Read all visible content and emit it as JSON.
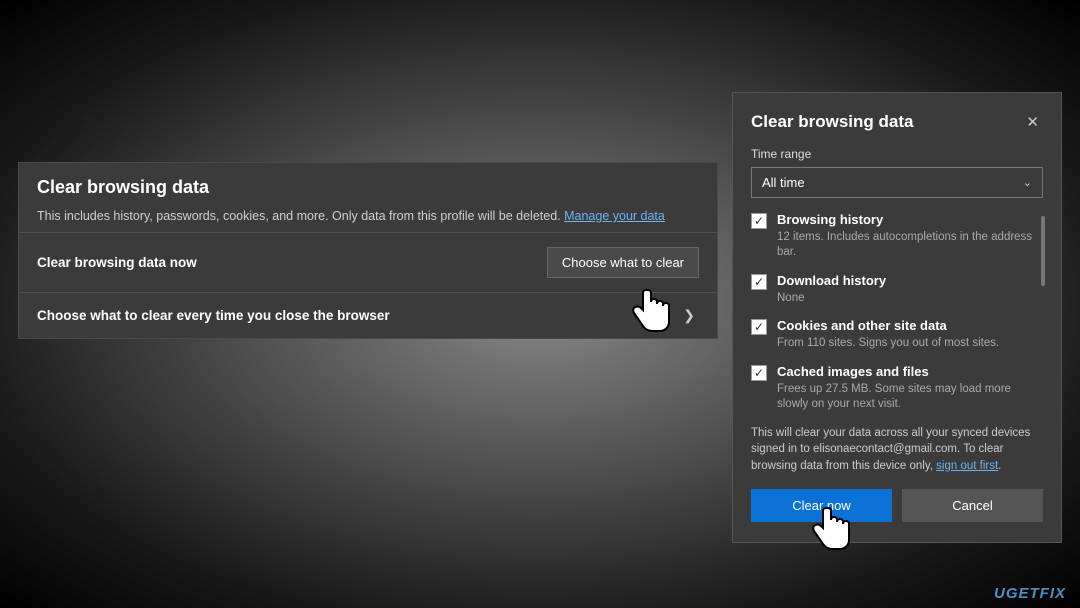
{
  "settings": {
    "title": "Clear browsing data",
    "subtitle_prefix": "This includes history, passwords, cookies, and more. Only data from this profile will be deleted. ",
    "subtitle_link": "Manage your data",
    "row1_label": "Clear browsing data now",
    "row1_button": "Choose what to clear",
    "row2_label": "Choose what to clear every time you close the browser"
  },
  "dialog": {
    "title": "Clear browsing data",
    "time_range_label": "Time range",
    "time_range_value": "All time",
    "items": [
      {
        "title": "Browsing history",
        "desc": "12 items. Includes autocompletions in the address bar.",
        "checked": true
      },
      {
        "title": "Download history",
        "desc": "None",
        "checked": true
      },
      {
        "title": "Cookies and other site data",
        "desc": "From 110 sites. Signs you out of most sites.",
        "checked": true
      },
      {
        "title": "Cached images and files",
        "desc": "Frees up 27.5 MB. Some sites may load more slowly on your next visit.",
        "checked": true
      }
    ],
    "notice_prefix": "This will clear your data across all your synced devices signed in to elisonaecontact@gmail.com. To clear browsing data from this device only, ",
    "notice_link": "sign out first",
    "notice_suffix": ".",
    "clear_button": "Clear now",
    "cancel_button": "Cancel"
  },
  "watermark": "UGETFIX"
}
